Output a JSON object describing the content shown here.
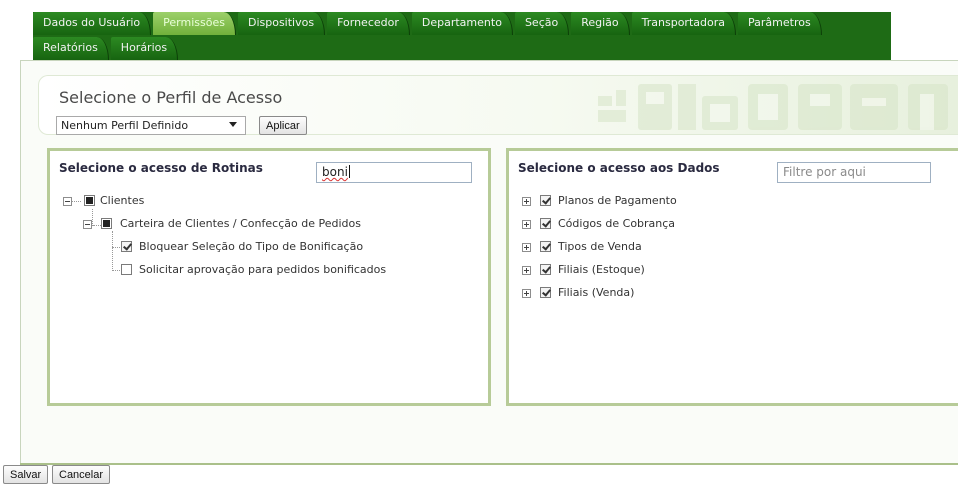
{
  "tabs": {
    "row1": [
      "Dados do Usuário",
      "Permissões",
      "Dispositivos",
      "Fornecedor",
      "Departamento",
      "Seção",
      "Região",
      "Transportadora",
      "Parâmetros"
    ],
    "row2": [
      "Relatórios",
      "Horários"
    ],
    "active": "Permissões"
  },
  "profile": {
    "title": "Selecione o Perfil de Acesso",
    "select_value": "Nenhum Perfil Definido",
    "apply_label": "Aplicar"
  },
  "routines": {
    "title": "Selecione o acesso de Rotinas",
    "search_value": "boni",
    "tree": [
      {
        "label": "Clientes",
        "state": "partial",
        "expander": "minus"
      },
      {
        "label": "Carteira de Clientes / Confecção de Pedidos",
        "state": "partial",
        "expander": "minus"
      },
      {
        "label": "Bloquear Seleção do Tipo de Bonificação",
        "state": "checked"
      },
      {
        "label": "Solicitar aprovação para pedidos bonificados",
        "state": "unchecked"
      }
    ]
  },
  "data_access": {
    "title": "Selecione o acesso aos Dados",
    "search_placeholder": "Filtre por aqui",
    "tree": [
      {
        "label": "Planos de Pagamento",
        "state": "checked",
        "expander": "plus"
      },
      {
        "label": "Códigos de Cobrança",
        "state": "checked",
        "expander": "plus"
      },
      {
        "label": "Tipos de Venda",
        "state": "checked",
        "expander": "plus"
      },
      {
        "label": "Filiais (Estoque)",
        "state": "checked",
        "expander": "plus"
      },
      {
        "label": "Filiais (Venda)",
        "state": "checked",
        "expander": "plus"
      }
    ]
  },
  "footer": {
    "save_label": "Salvar",
    "cancel_label": "Cancelar"
  },
  "colors": {
    "tab_dark": "#1e6b15",
    "tab_active": "#8cc35a",
    "box_border": "#b7cb98"
  }
}
